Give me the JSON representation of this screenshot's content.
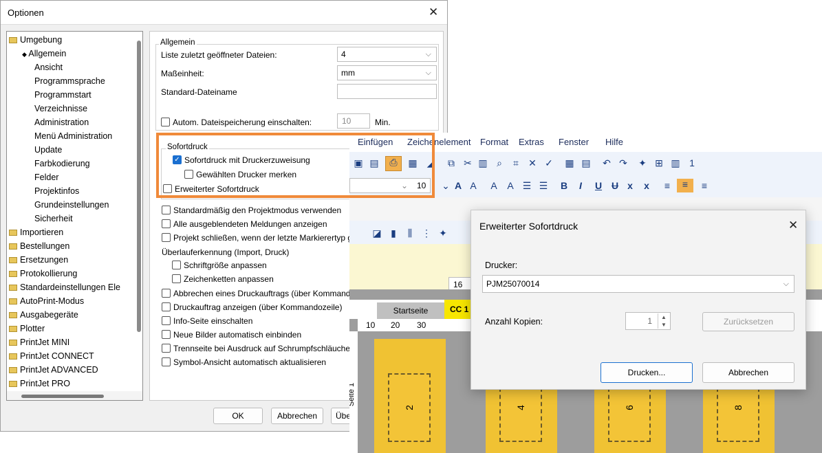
{
  "options_dialog": {
    "title": "Optionen",
    "close": "✕",
    "tree": [
      {
        "label": "Umgebung",
        "folder": true
      },
      {
        "label": "Allgemein",
        "selected": true
      },
      {
        "label": "Ansicht"
      },
      {
        "label": "Programmsprache"
      },
      {
        "label": "Programmstart"
      },
      {
        "label": "Verzeichnisse"
      },
      {
        "label": "Administration"
      },
      {
        "label": "Menü Administration"
      },
      {
        "label": "Update"
      },
      {
        "label": "Farbkodierung"
      },
      {
        "label": "Felder"
      },
      {
        "label": "Projektinfos"
      },
      {
        "label": "Grundeinstellungen"
      },
      {
        "label": "Sicherheit"
      },
      {
        "label": "Importieren",
        "folder": true
      },
      {
        "label": "Bestellungen",
        "folder": true
      },
      {
        "label": "Ersetzungen",
        "folder": true
      },
      {
        "label": "Protokollierung",
        "folder": true
      },
      {
        "label": "Standardeinstellungen Ele",
        "folder": true
      },
      {
        "label": "AutoPrint-Modus",
        "folder": true
      },
      {
        "label": "Ausgabegeräte",
        "folder": true
      },
      {
        "label": "Plotter",
        "folder": true
      },
      {
        "label": "PrintJet MINI",
        "folder": true
      },
      {
        "label": "PrintJet CONNECT",
        "folder": true
      },
      {
        "label": "PrintJet ADVANCED",
        "folder": true
      },
      {
        "label": "PrintJet PRO",
        "folder": true
      }
    ],
    "general": {
      "caption": "Allgemein",
      "recent_files_label": "Liste zuletzt geöffneter Dateien:",
      "recent_files_value": "4",
      "unit_label": "Maßeinheit:",
      "unit_value": "mm",
      "default_filename_label": "Standard-Dateiname",
      "default_filename_value": "",
      "autosave_label": "Autom. Dateispeicherung einschalten:",
      "autosave_value": "10",
      "autosave_unit": "Min."
    },
    "sofortdruck": {
      "caption": "Sofortdruck",
      "printer_assign": "Sofortdruck mit Druckerzuweisung",
      "remember_printer": "Gewählten Drucker merken",
      "extended": "Erweiterter Sofortdruck"
    },
    "options": [
      "Standardmäßig den Projektmodus verwenden",
      "Alle ausgeblendeten Meldungen anzeigen",
      "Projekt schließen, wenn der letzte Markierertyp g"
    ],
    "overflow_label": "Überlauferkennung (Import, Druck)",
    "overflow_options": [
      "Schriftgröße anpassen",
      "Zeichenketten anpassen"
    ],
    "options2": [
      "Abbrechen eines Druckauftrags (über Kommando",
      "Druckauftrag anzeigen (über Kommandozeile)",
      "Info-Seite einschalten",
      "Neue Bilder automatisch einbinden",
      "Trennseite bei Ausdruck auf Schrumpfschläuche",
      "Symbol-Ansicht automatisch aktualisieren"
    ],
    "buttons": {
      "ok": "OK",
      "cancel": "Abbrechen",
      "apply": "Über"
    }
  },
  "app": {
    "menus": [
      "Einfügen",
      "Zeichenelement",
      "Format",
      "Extras",
      "Fenster",
      "Hilfe"
    ],
    "font_size": "10",
    "font_size_field": "16",
    "toolbar_number": "1",
    "tabs": [
      "Startseite",
      "CC 1"
    ],
    "ruler": [
      "10",
      "20",
      "30"
    ],
    "page_label": "Seite 1",
    "cells": [
      "2",
      "4",
      "6",
      "8"
    ]
  },
  "sofortdruck_dialog": {
    "title": "Erweiterter Sofortdruck",
    "close": "✕",
    "printer_label": "Drucker:",
    "printer_value": "PJM25070014",
    "copies_label": "Anzahl Kopien:",
    "copies_value": "1",
    "reset": "Zurücksetzen",
    "print": "Drucken...",
    "cancel": "Abbrechen"
  },
  "colors": {
    "highlight": "#f08a3a",
    "label_yellow": "#f3c437",
    "accent": "#1a6fd0"
  }
}
